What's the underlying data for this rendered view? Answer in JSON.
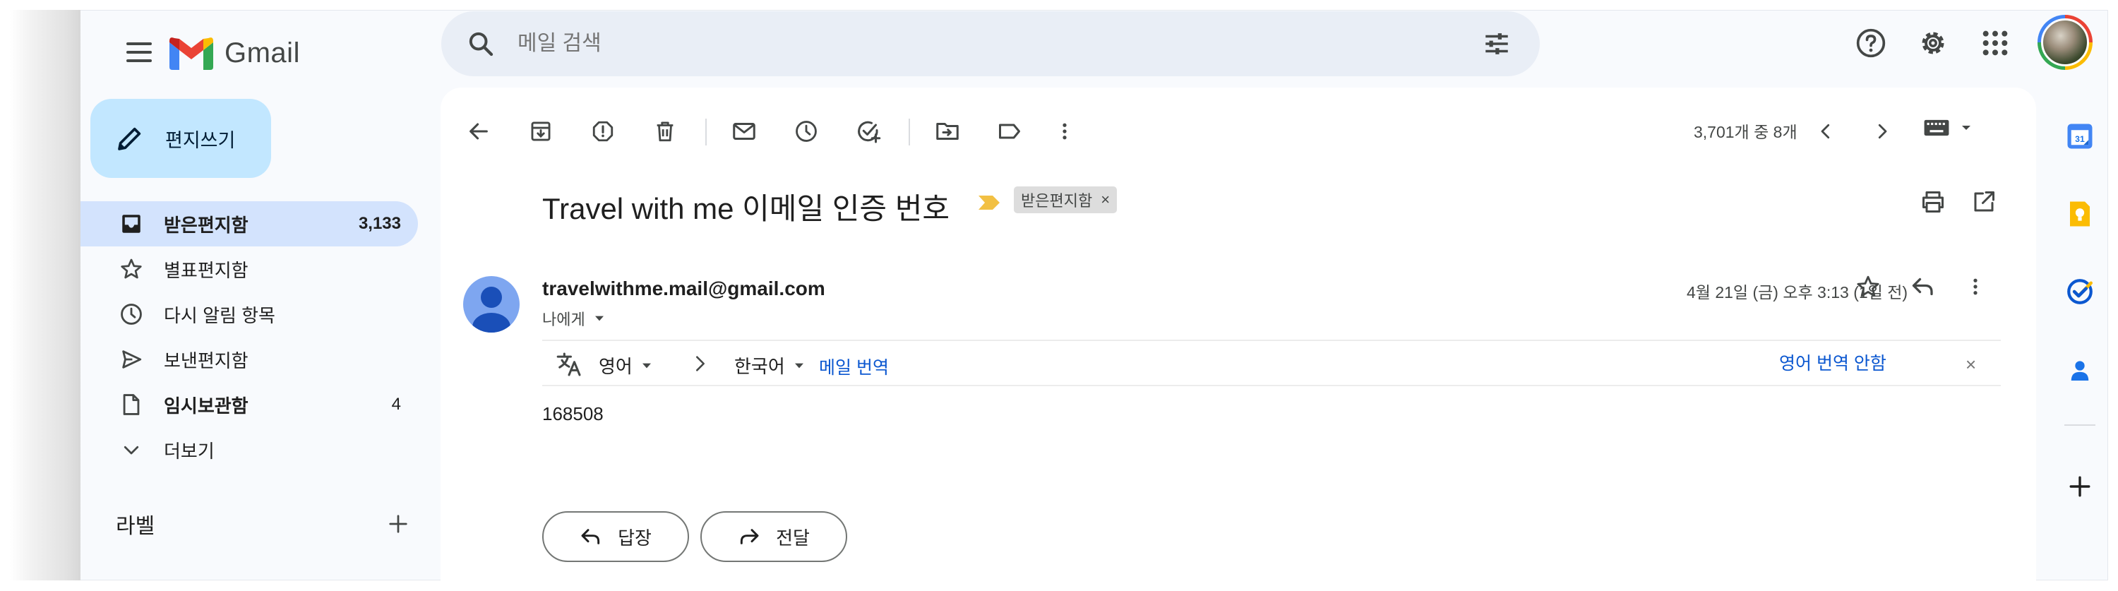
{
  "app": {
    "name": "Gmail"
  },
  "search": {
    "placeholder": "메일 검색"
  },
  "compose": {
    "label": "편지쓰기"
  },
  "sidebar": {
    "items": [
      {
        "label": "받은편지함",
        "count": "3,133",
        "icon": "inbox-icon"
      },
      {
        "label": "별표편지함",
        "count": "",
        "icon": "star-icon"
      },
      {
        "label": "다시 알림 항목",
        "count": "",
        "icon": "clock-icon"
      },
      {
        "label": "보낸편지함",
        "count": "",
        "icon": "send-icon"
      },
      {
        "label": "임시보관함",
        "count": "4",
        "icon": "draft-icon"
      },
      {
        "label": "더보기",
        "count": "",
        "icon": "chevron-down-icon"
      }
    ],
    "labels_title": "라벨"
  },
  "toolbar": {
    "page_count": "3,701개 중 8개"
  },
  "message": {
    "subject": "Travel with me 이메일 인증 번호",
    "label_chip": "받은편지함",
    "label_chip_close": "×",
    "sender": "travelwithme.mail@gmail.com",
    "recipient": "나에게",
    "date": "4월 21일 (금) 오후 3:13 (1일 전)",
    "body": "168508"
  },
  "translate": {
    "from_lang": "영어",
    "to_lang": "한국어",
    "translate_link": "메일 번역",
    "dont_translate": "영어 번역 안함",
    "close": "×"
  },
  "actions": {
    "reply": "답장",
    "forward": "전달"
  },
  "colors": {
    "accent": "#0b57d0",
    "compose_bg": "#c2e7ff",
    "active_nav_bg": "#d3e3fd",
    "search_bg": "#e9eef6",
    "app_bg": "#f8fafd",
    "importance_marker": "#f2c043"
  }
}
